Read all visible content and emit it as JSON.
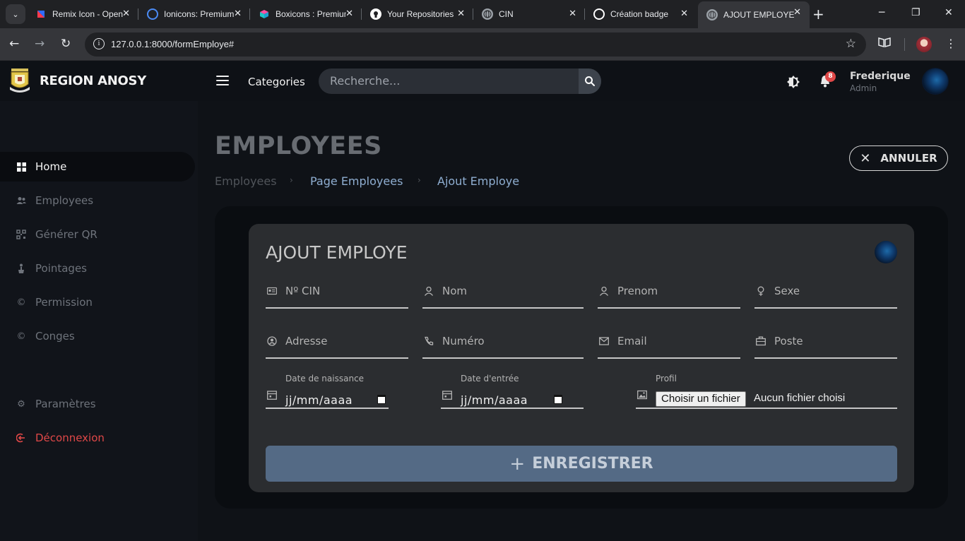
{
  "browser": {
    "tabs": [
      {
        "title": "Remix Icon - Open",
        "icon": "remix-icon",
        "color": "#2f6bff"
      },
      {
        "title": "Ionicons: Premium",
        "icon": "ionicons-icon",
        "color": "#4b8bf5"
      },
      {
        "title": "Boxicons : Premium",
        "icon": "boxicons-icon",
        "color": "#1ec7c7"
      },
      {
        "title": "Your Repositories",
        "icon": "github-icon",
        "color": "#ffffff"
      },
      {
        "title": "CIN",
        "icon": "globe-icon",
        "color": "#9aa0a6"
      },
      {
        "title": "Création badge",
        "icon": "openai-icon",
        "color": "#ffffff"
      },
      {
        "title": "AJOUT EMPLOYE",
        "icon": "globe-icon",
        "color": "#9aa0a6"
      }
    ],
    "url": "127.0.0.1:8000/formEmploye#"
  },
  "header": {
    "brand": "REGION ANOSY",
    "categories": "Categories",
    "search_placeholder": "Recherche...",
    "notifications": "8",
    "user_name": "Frederique",
    "user_role": "Admin"
  },
  "sidebar": {
    "items": [
      {
        "label": "Home",
        "icon": "grid-icon"
      },
      {
        "label": "Employees",
        "icon": "users-icon"
      },
      {
        "label": "Générer QR",
        "icon": "qr-icon"
      },
      {
        "label": "Pointages",
        "icon": "pointer-icon"
      },
      {
        "label": "Permission",
        "icon": "copyright-icon"
      },
      {
        "label": "Conges",
        "icon": "copyright-icon"
      },
      {
        "label": "Paramètres",
        "icon": "gear-icon"
      },
      {
        "label": "Déconnexion",
        "icon": "logout-icon"
      }
    ]
  },
  "main": {
    "title": "EMPLOYEES",
    "breadcrumb": [
      "Employees",
      "Page Employees",
      "Ajout Employe"
    ],
    "cancel_label": "ANNULER"
  },
  "form": {
    "title": "AJOUT EMPLOYE",
    "fields": {
      "cin": "Nº CIN",
      "nom": "Nom",
      "prenom": "Prenom",
      "sexe": "Sexe",
      "adresse": "Adresse",
      "numero": "Numéro",
      "email": "Email",
      "poste": "Poste"
    },
    "date_naissance": {
      "label": "Date de naissance",
      "value": "jj/mm/aaaa"
    },
    "date_entree": {
      "label": "Date d'entrée",
      "value": "jj/mm/aaaa"
    },
    "profil": {
      "label": "Profil",
      "button": "Choisir un fichier",
      "status": "Aucun fichier choisi"
    },
    "submit_label": "ENREGISTRER"
  },
  "colors": {
    "accent": "#546a85",
    "danger": "#e04848",
    "link": "#8faed1"
  }
}
